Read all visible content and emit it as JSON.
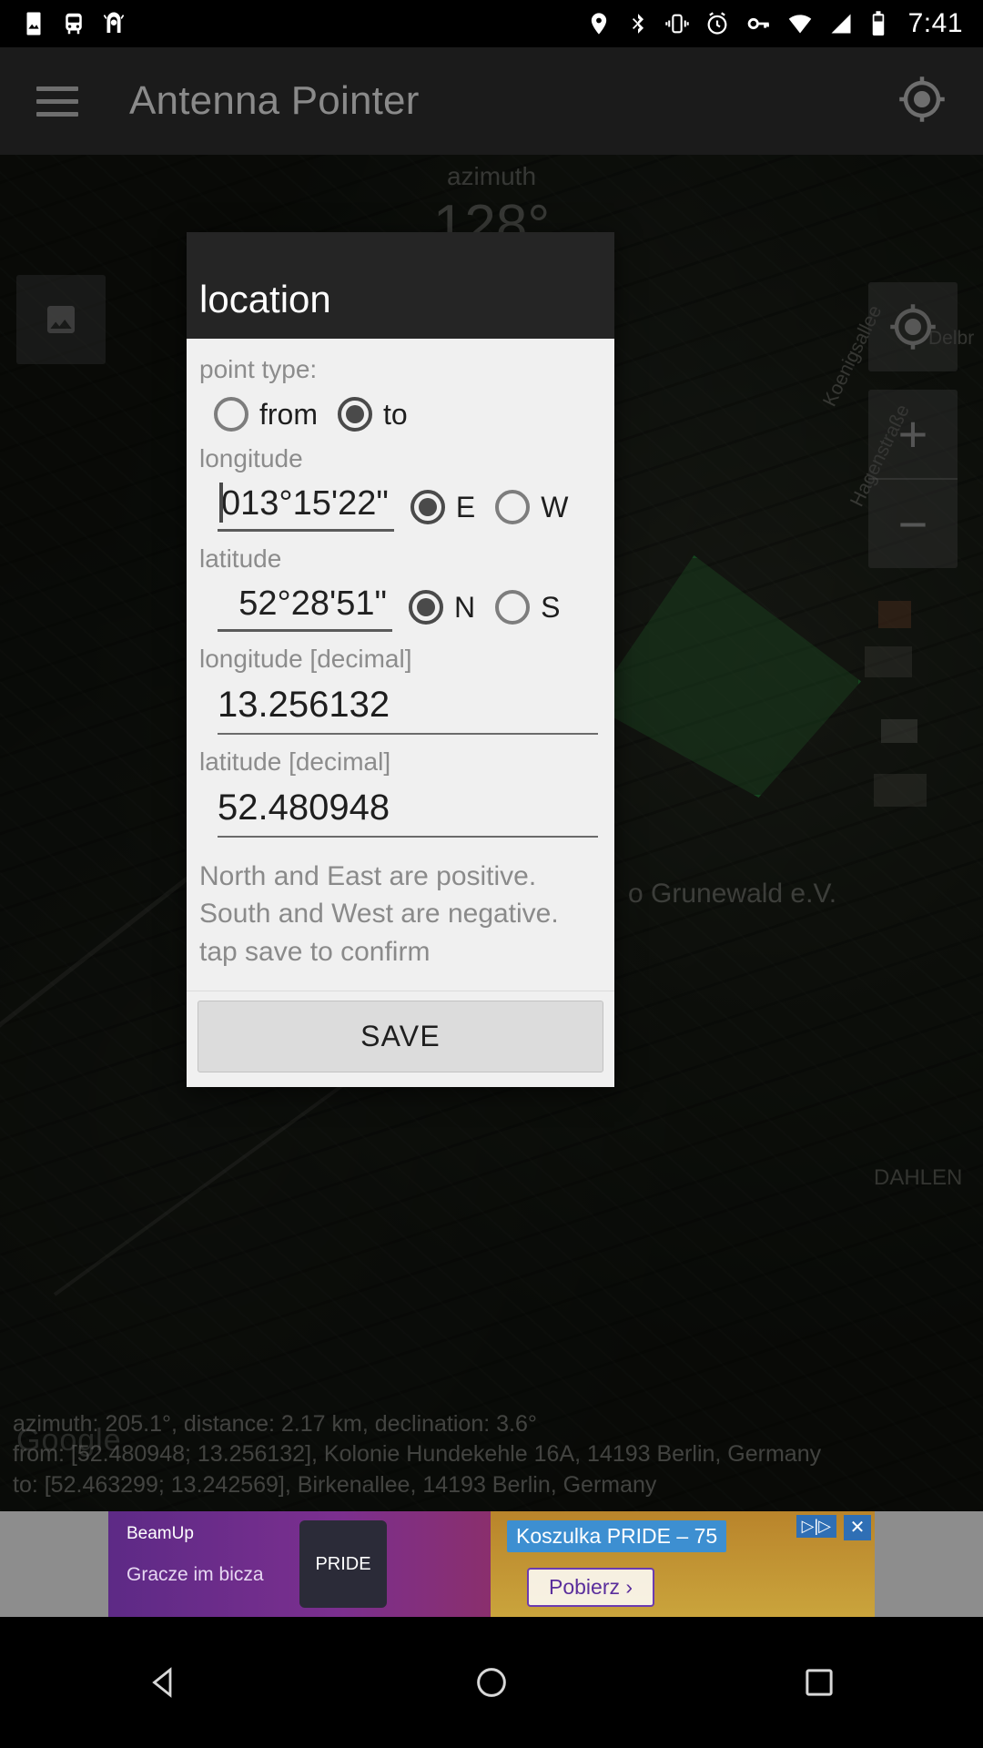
{
  "status_bar": {
    "time": "7:41",
    "left_icons": [
      "photo-icon",
      "bus-icon",
      "landmark-icon"
    ],
    "right_icons": [
      "location-pin-icon",
      "bluetooth-icon",
      "vibrate-icon",
      "alarm-icon",
      "vpn-key-icon",
      "wifi-icon",
      "cell-signal-icon",
      "battery-icon"
    ]
  },
  "app_bar": {
    "menu_icon": "hamburger-menu-icon",
    "title": "Antenna Pointer",
    "action_icon": "my-location-crosshair-icon"
  },
  "map": {
    "azimuth_label": "azimuth",
    "azimuth_value": "128°",
    "poi_label": "o Grunewald e.V.",
    "street_labels": [
      "Koenigsallee",
      "Hagenstraße",
      "Delbr",
      "DAHLEN"
    ],
    "watermark": "Google",
    "controls": {
      "my_location_icon": "my-location-crosshair-icon",
      "zoom_in": "+",
      "zoom_out": "−",
      "thumbnail_icon": "image-placeholder-icon"
    },
    "info_lines": [
      "azimuth: 205.1°, distance: 2.17 km, declination: 3.6°",
      "from: [52.480948; 13.256132], Kolonie Hundekehle 16A, 14193 Berlin, Germany",
      "to: [52.463299; 13.242569], Birkenallee, 14193 Berlin, Germany"
    ]
  },
  "dialog": {
    "title": "location",
    "point_type": {
      "label": "point type:",
      "options": [
        {
          "label": "from",
          "selected": false
        },
        {
          "label": "to",
          "selected": true
        }
      ]
    },
    "longitude": {
      "label": "longitude",
      "value": "013°15'22\"",
      "directions": [
        {
          "label": "E",
          "selected": true
        },
        {
          "label": "W",
          "selected": false
        }
      ]
    },
    "latitude": {
      "label": "latitude",
      "value": "52°28'51\"",
      "directions": [
        {
          "label": "N",
          "selected": true
        },
        {
          "label": "S",
          "selected": false
        }
      ]
    },
    "longitude_decimal": {
      "label": "longitude [decimal]",
      "value": "13.256132"
    },
    "latitude_decimal": {
      "label": "latitude [decimal]",
      "value": "52.480948"
    },
    "help_lines": [
      "North and East are positive.",
      "South and West are negative.",
      "tap save to confirm"
    ],
    "save_label": "SAVE"
  },
  "ad": {
    "brand": "BeamUp",
    "brand_sub": "Gracze\nim bicza",
    "badge": "PRIDE",
    "headline": "Koszulka PRIDE – 75",
    "cta": "Pobierz  ›",
    "adchoices": "▷|▷",
    "close": "✕"
  },
  "nav_bar": {
    "back_icon": "nav-back-triangle-icon",
    "home_icon": "nav-home-circle-icon",
    "recents_icon": "nav-recents-square-icon"
  },
  "colors": {
    "dialog_header_bg": "#252525",
    "dialog_body_bg": "#f0f0f0",
    "accent_radio": "#4a4a4a",
    "app_bar_bg": "#1b1b1b",
    "save_button_bg": "#dcdcdc"
  }
}
